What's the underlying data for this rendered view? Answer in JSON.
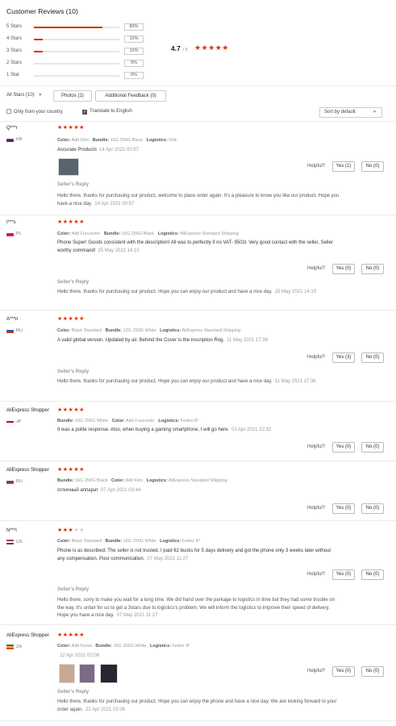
{
  "header": {
    "title": "Customer Reviews (10)"
  },
  "distribution": [
    {
      "label": "5 Stars",
      "percent": "80%",
      "fill": 0.8
    },
    {
      "label": "4 Stars",
      "percent": "10%",
      "fill": 0.1
    },
    {
      "label": "3 Stars",
      "percent": "10%",
      "fill": 0.1
    },
    {
      "label": "2 Stars",
      "percent": "0%",
      "fill": 0
    },
    {
      "label": "1 Star",
      "percent": "0%",
      "fill": 0
    }
  ],
  "average": {
    "value": "4.7",
    "of": "/ 5",
    "stars": "★★★★★"
  },
  "filters": {
    "all_stars": "All Stars (10)",
    "photos": "Photos (2)",
    "additional": "Additional Feedback (0)",
    "only_country": "Only from your country",
    "translate": "Translate to English",
    "sort": "Sort by default"
  },
  "helpful_label": "Helpful?",
  "reply_label": "Seller's Reply",
  "colors": {
    "accent": "#e62e04"
  },
  "reviews": [
    {
      "name": "Q***r",
      "country": "KR",
      "stars": "★★★★★",
      "dim_stars": "",
      "meta": [
        [
          "Color:",
          "Add Film"
        ],
        [
          "Bundle:",
          "16G 256G Black"
        ],
        [
          "Logistics:",
          "DHL"
        ]
      ],
      "text": "Accurate Products",
      "date": "14 Apr 2021 00:57",
      "yes": "Yes (1)",
      "no": "No (0)",
      "reply": "Hello there, thanks for purchasing our product, welcome to place order again. It's a pleasure to know you like our product. Hope you have a nice day.",
      "reply_date": "14 Apr 2021 00:57"
    },
    {
      "name": "I***s",
      "country": "PL",
      "stars": "★★★★★",
      "dim_stars": "",
      "meta": [
        [
          "Color:",
          "Add Funcooler"
        ],
        [
          "Bundle:",
          "16G 256G Black"
        ],
        [
          "Logistics:",
          "AliExpress Standard Shipping"
        ]
      ],
      "text": "Phone Super! Goods consistent with the description! All was to perfectly if no VAT- 950zł. Very good contact with the seller, Seller worthy command!",
      "date": "25 May 2021 14:10",
      "yes": "Yes (0)",
      "no": "No (0)",
      "reply": "Hello there, thanks for purchasing our product. Hope you can enjoy our product and have a nice day.",
      "reply_date": "25 May 2021 14:10"
    },
    {
      "name": "A***n",
      "country": "RU",
      "stars": "★★★★★",
      "dim_stars": "",
      "meta": [
        [
          "Color:",
          "Black Standard"
        ],
        [
          "Bundle:",
          "12G 256G White"
        ],
        [
          "Logistics:",
          "AliExpress Standard Shipping"
        ]
      ],
      "text": "A valid global version. Updated by air. Behind the Cover is the inscription Rog.",
      "date": "11 May 2021 17:36",
      "yes": "Yes (3)",
      "no": "No (0)",
      "reply": "Hello there, thanks for purchasing our product. Hope you can enjoy our product and have a nice day.",
      "reply_date": "11 May 2021 17:36"
    },
    {
      "name": "AliExpress Shopper",
      "country": "JP",
      "stars": "★★★★★",
      "dim_stars": "",
      "meta": [
        [
          "Bundle:",
          "16G 256G White"
        ],
        [
          "Color:",
          "Add Funcooler"
        ],
        [
          "Logistics:",
          "Fedex IP"
        ]
      ],
      "text": "It was a polite response. Also, when buying a gaming smartphone, I will go here.",
      "date": "01 Apr 2021 22:32",
      "yes": "Yes (0)",
      "no": "No (0)"
    },
    {
      "name": "AliExpress Shopper",
      "country": "RU",
      "stars": "★★★★★",
      "dim_stars": "",
      "meta": [
        [
          "Bundle:",
          "16G 256G Black"
        ],
        [
          "Color:",
          "Add Film"
        ],
        [
          "Logistics:",
          "AliExpress Standard Shipping"
        ]
      ],
      "text": "отличный аппарат",
      "date": "07 Apr 2021 03:44",
      "yes": "Yes (0)",
      "no": "No (0)"
    },
    {
      "name": "N***l",
      "country": "US",
      "stars": "★★★",
      "dim_stars": "★★",
      "meta": [
        [
          "Color:",
          "Black Standard"
        ],
        [
          "Bundle:",
          "16G 256G White"
        ],
        [
          "Logistics:",
          "Fedex IP"
        ]
      ],
      "text": "Phone is as described. The seller is not trusted. I paid 62 bucks for 5 days delivery and got the phone only 3 weeks later without any compensation. Poor communication.",
      "date": "07 May 2021 11:27",
      "yes": "Yes (0)",
      "no": "No (0)",
      "reply": "Hello there, sorry to make you wait for a long time. We did hand over the parkage to logistics in time but they had some trouble on the way. It's unfair for us to get a 3stars due to logistics's problem. We will inform the logistics to improve their speed of delivery. Hope you have a nice day.",
      "reply_date": "07 May 2021 11:27"
    },
    {
      "name": "AliExpress Shopper",
      "country": "ZA",
      "stars": "★★★★★",
      "dim_stars": "",
      "meta": [
        [
          "Color:",
          "Add Kunai"
        ],
        [
          "Bundle:",
          "16G 256G White"
        ],
        [
          "Logistics:",
          "Fedex IP"
        ]
      ],
      "text": "",
      "date": "22 Apr 2021 02:06",
      "yes": "Yes (0)",
      "no": "No (0)",
      "reply": "Hello there, thanks for purchasing our product. Hope you can enjoy the phone and have a nice day. We are looking forward to your order again.",
      "reply_date": "22 Apr 2021 02:06"
    }
  ]
}
